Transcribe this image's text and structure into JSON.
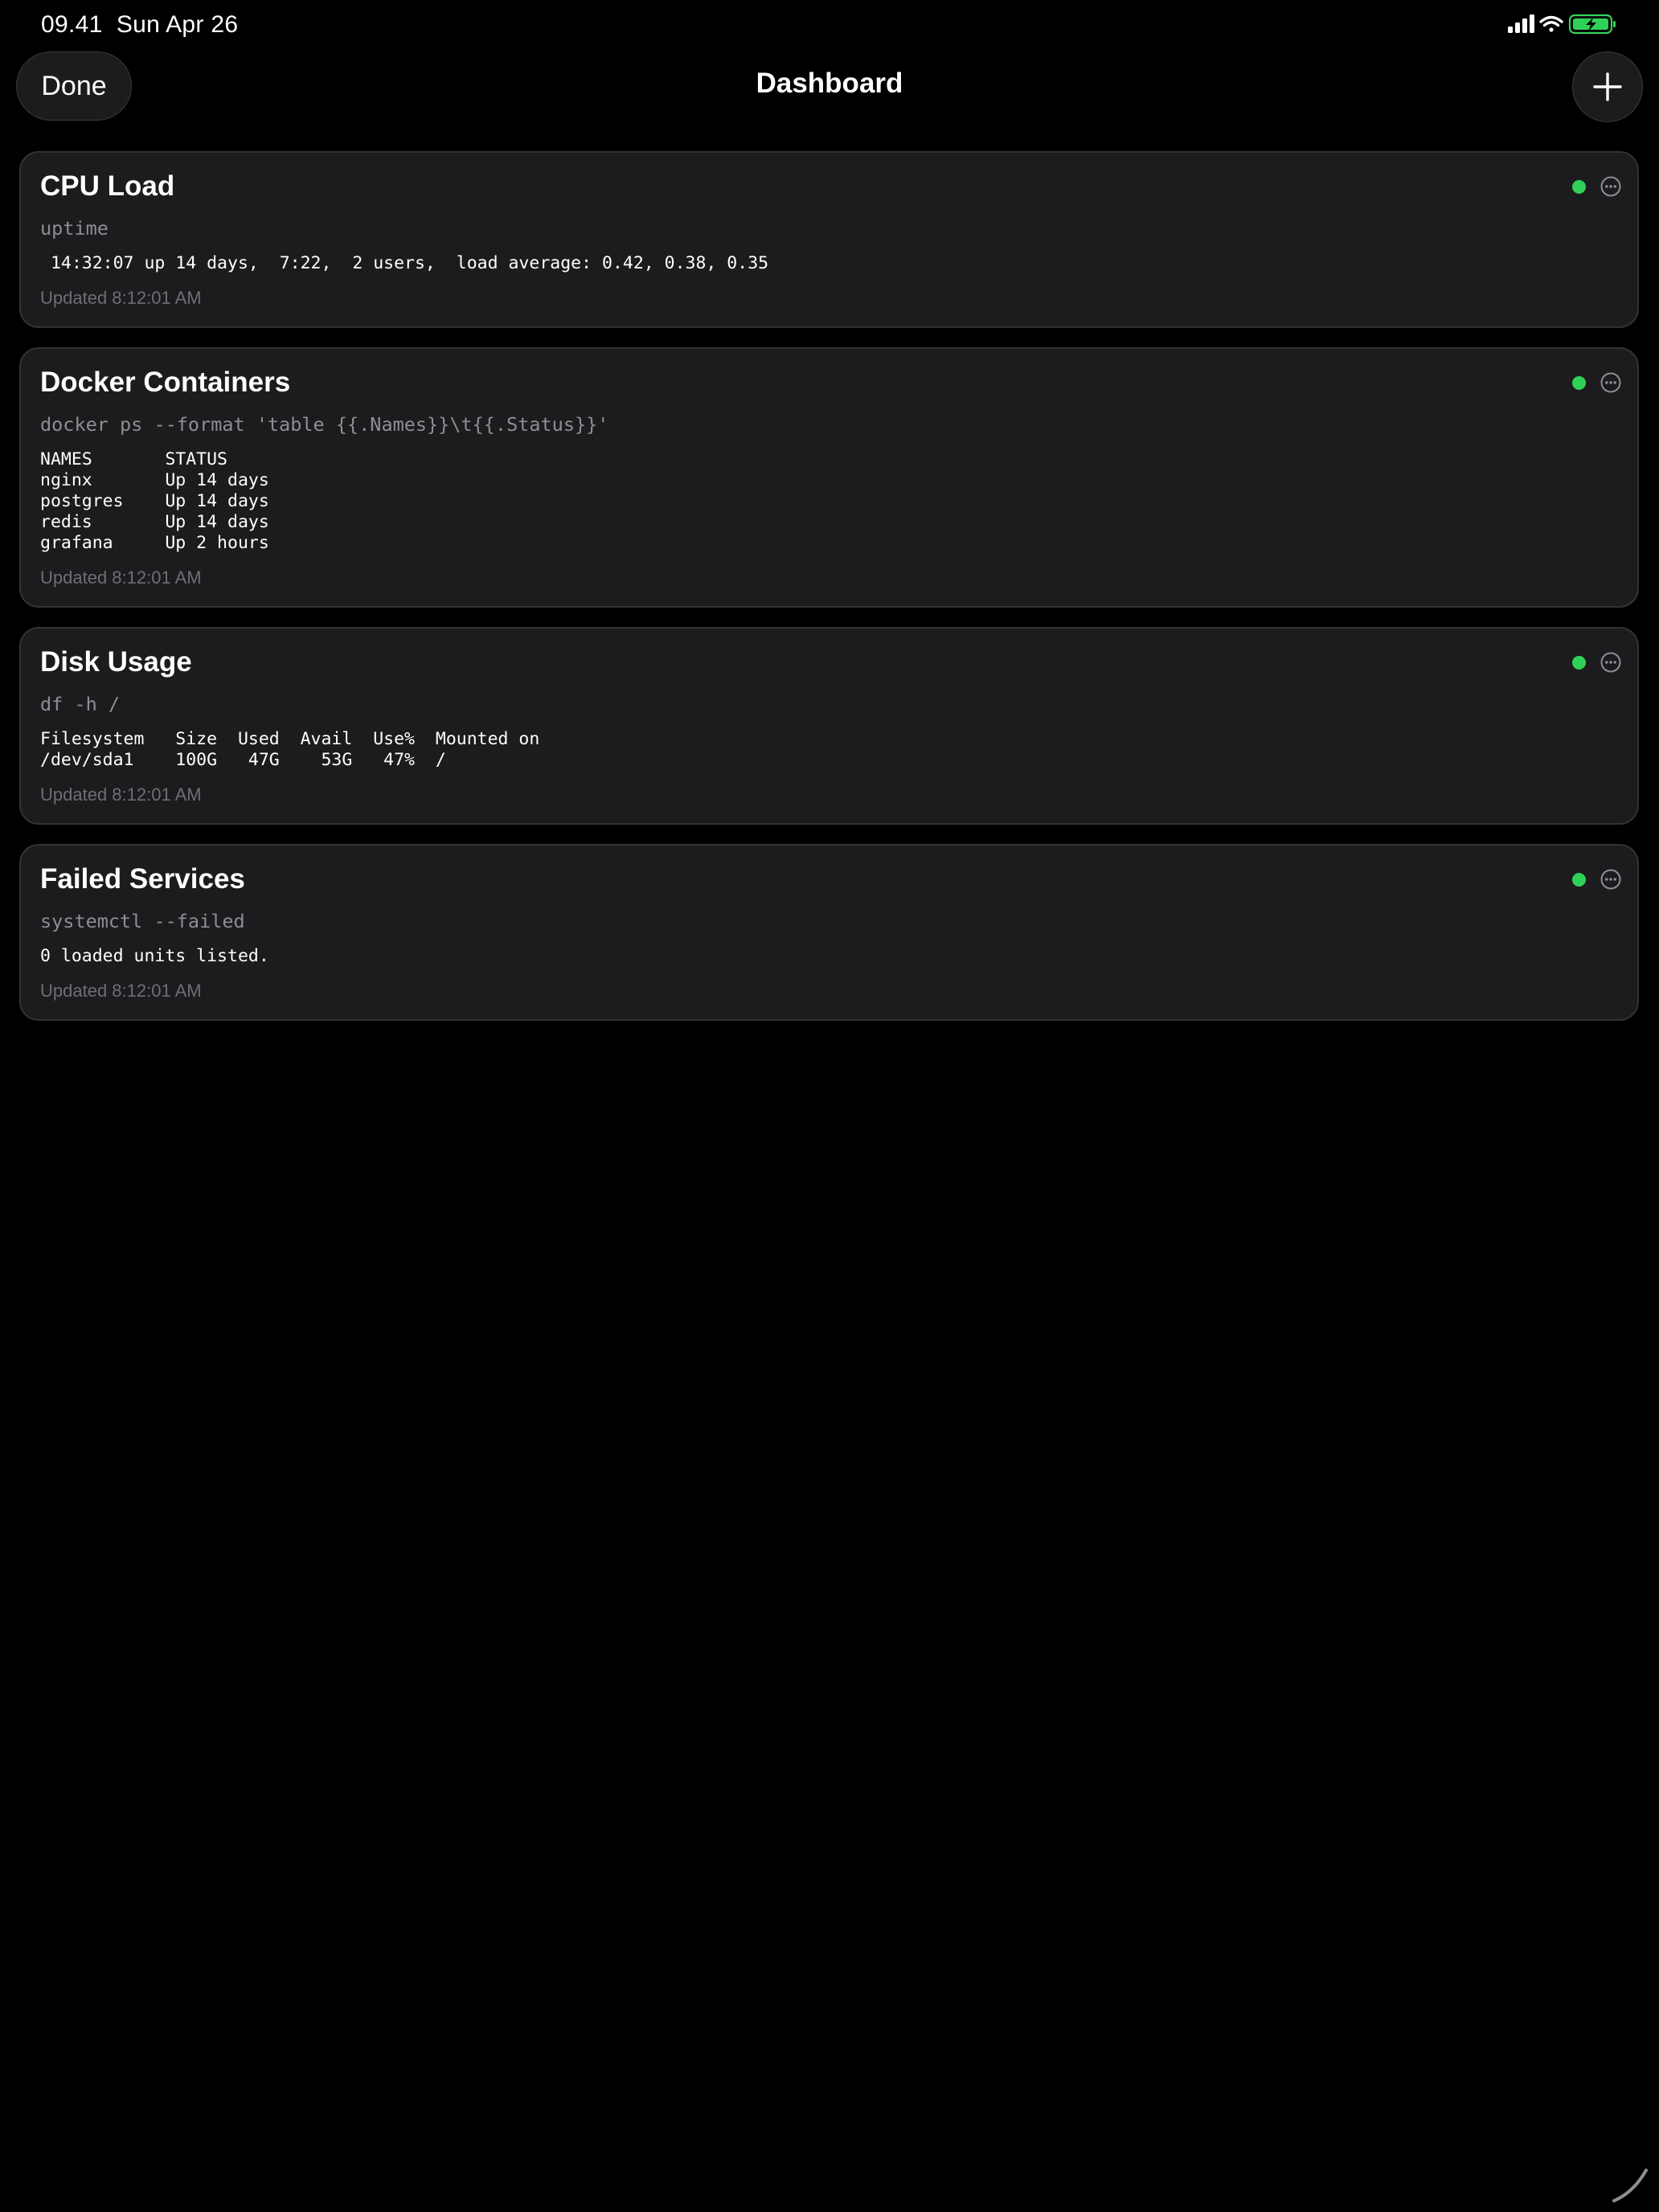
{
  "status_bar": {
    "time": "09.41",
    "date": "Sun Apr 26"
  },
  "nav": {
    "done_label": "Done",
    "title": "Dashboard"
  },
  "colors": {
    "background": "#000000",
    "card": "#1c1c1e",
    "status_ok": "#30d158",
    "command_text": "#8e8e93"
  },
  "widgets": [
    {
      "title": "CPU Load",
      "command": "uptime",
      "output": " 14:32:07 up 14 days,  7:22,  2 users,  load average: 0.42, 0.38, 0.35",
      "updated": "Updated 8:12:01 AM",
      "status": "ok"
    },
    {
      "title": "Docker Containers",
      "command": "docker ps --format 'table {{.Names}}\\t{{.Status}}'",
      "output": "NAMES       STATUS\nnginx       Up 14 days\npostgres    Up 14 days\nredis       Up 14 days\ngrafana     Up 2 hours",
      "updated": "Updated 8:12:01 AM",
      "status": "ok"
    },
    {
      "title": "Disk Usage",
      "command": "df -h /",
      "output": "Filesystem   Size  Used  Avail  Use%  Mounted on\n/dev/sda1    100G   47G    53G   47%  /",
      "updated": "Updated 8:12:01 AM",
      "status": "ok"
    },
    {
      "title": "Failed Services",
      "command": "systemctl --failed",
      "output": "0 loaded units listed.",
      "updated": "Updated 8:12:01 AM",
      "status": "ok"
    }
  ]
}
